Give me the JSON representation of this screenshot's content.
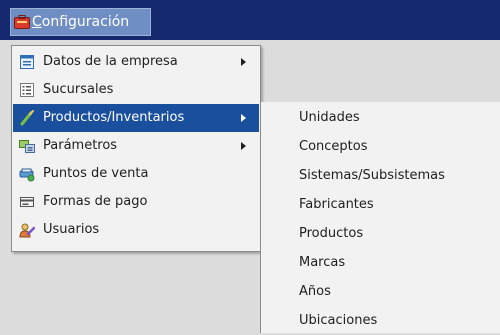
{
  "menubar": {
    "menu_label": "Configuración",
    "menu_icon": "toolbox-icon"
  },
  "dropdown": {
    "items": [
      {
        "label": "Datos de la empresa",
        "icon": "window-icon",
        "submenu": true
      },
      {
        "label": "Sucursales",
        "icon": "list-icon",
        "submenu": false
      },
      {
        "label": "Productos/Inventarios",
        "icon": "brush-icon",
        "submenu": true,
        "selected": true
      },
      {
        "label": "Parámetros",
        "icon": "settings-panel-icon",
        "submenu": true
      },
      {
        "label": "Puntos de venta",
        "icon": "printer-icon",
        "submenu": false
      },
      {
        "label": "Formas de pago",
        "icon": "card-icon",
        "submenu": false
      },
      {
        "label": "Usuarios",
        "icon": "users-icon",
        "submenu": false
      }
    ]
  },
  "submenu": {
    "items": [
      "Unidades",
      "Conceptos",
      "Sistemas/Subsistemas",
      "Fabricantes",
      "Productos",
      "Marcas",
      "Años",
      "Ubicaciones"
    ]
  },
  "colors": {
    "menubar": "#152a6e",
    "menu_title_bg": "#6f8fc4",
    "selection": "#1a4f9e",
    "menu_bg": "#f2f2f2"
  }
}
